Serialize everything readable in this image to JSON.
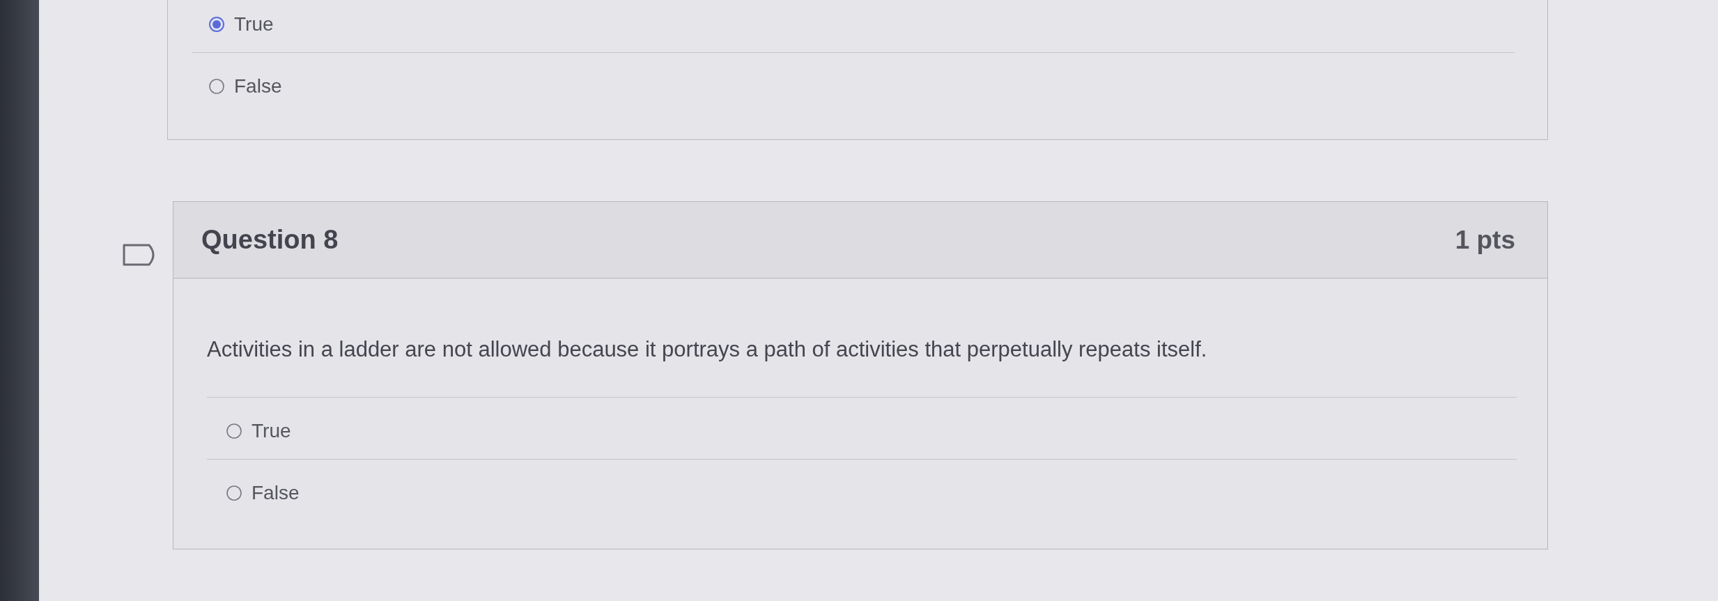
{
  "previous_question": {
    "answers": [
      {
        "label": "True",
        "selected": true
      },
      {
        "label": "False",
        "selected": false
      }
    ]
  },
  "question": {
    "title": "Question 8",
    "points": "1 pts",
    "flagged": false,
    "text": "Activities in a ladder are not allowed because it portrays a path of activities that perpetually repeats itself.",
    "answers": [
      {
        "label": "True",
        "selected": false
      },
      {
        "label": "False",
        "selected": false
      }
    ]
  }
}
